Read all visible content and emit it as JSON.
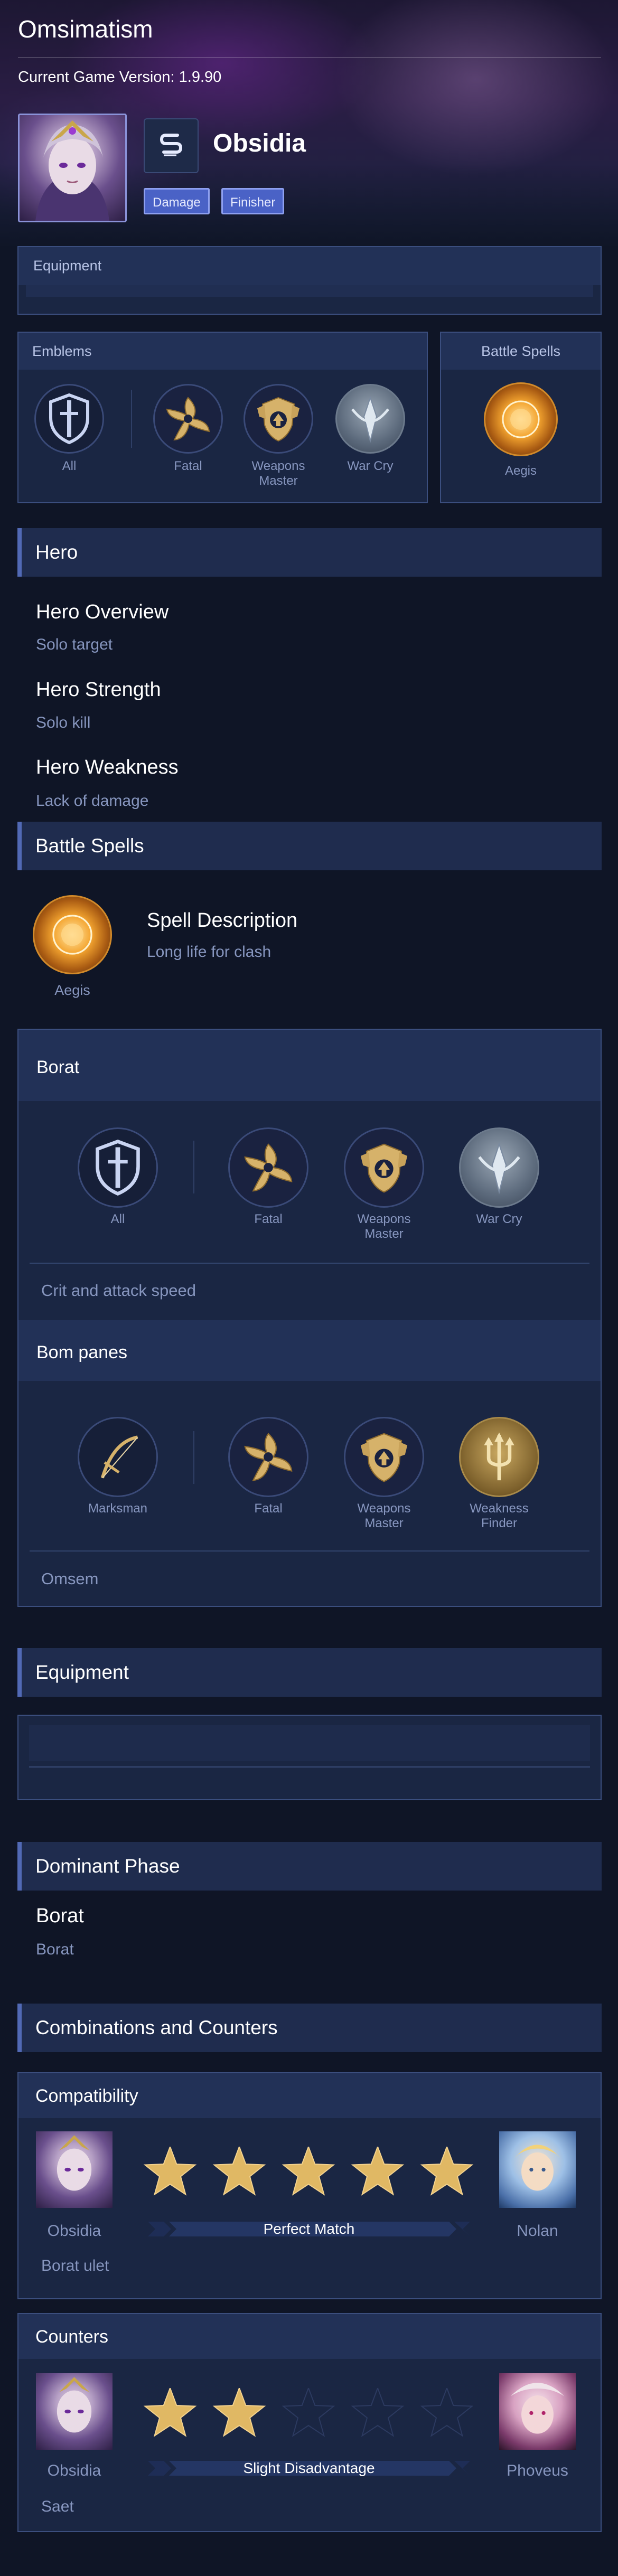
{
  "header": {
    "title": "Omsimatism",
    "version": "Current Game Version: 1.9.90"
  },
  "hero": {
    "name": "Obsidia",
    "tags": [
      "Damage",
      "Finisher"
    ]
  },
  "top_equipment": {
    "label": "Equipment"
  },
  "emblems_panel": {
    "label": "Emblems",
    "items": [
      {
        "label": "All",
        "icon": "sword-shield-icon"
      },
      {
        "label": "Fatal",
        "icon": "shuriken-icon"
      },
      {
        "label": "Weapons\nMaster",
        "icon": "armor-crest-icon"
      },
      {
        "label": "War Cry",
        "icon": "crystal-icon"
      }
    ]
  },
  "spells_panel": {
    "label": "Battle Spells",
    "spell": "Aegis"
  },
  "hero_section": {
    "title": "Hero",
    "overview_title": "Hero Overview",
    "overview_value": "Solo target",
    "strength_title": "Hero Strength",
    "strength_value": "Solo kill",
    "weakness_title": "Hero Weakness",
    "weakness_value": "Lack of damage"
  },
  "battle_spells": {
    "title": "Battle Spells",
    "spell_name": "Aegis",
    "desc_title": "Spell Description",
    "desc_value": "Long life for clash"
  },
  "emblem_builds": [
    {
      "title": "Borat",
      "items": [
        "All",
        "Fatal",
        "Weapons\nMaster",
        "War Cry"
      ],
      "note": "Crit and attack speed"
    },
    {
      "title": "Bom panes",
      "items": [
        "Marksman",
        "Fatal",
        "Weapons\nMaster",
        "Weakness\nFinder"
      ],
      "note": "Omsem"
    }
  ],
  "equipment_section": {
    "title": "Equipment"
  },
  "dominant_phase": {
    "title": "Dominant Phase",
    "phase": "Borat",
    "detail": "Borat"
  },
  "combos": {
    "title": "Combinations and Counters",
    "compatibility": {
      "label": "Compatibility",
      "left": "Obsidia",
      "right": "Nolan",
      "rating": 5,
      "max": 5,
      "verdict": "Perfect Match",
      "note": "Borat ulet"
    },
    "counters": {
      "label": "Counters",
      "left": "Obsidia",
      "right": "Phoveus",
      "rating": 2,
      "max": 5,
      "verdict": "Slight Disadvantage",
      "note": "Saet"
    }
  },
  "colors": {
    "accent": "#5169b5",
    "tag_bg": "#4a62c6",
    "star_gold": "#e0b864",
    "panel": "#1a2643"
  }
}
